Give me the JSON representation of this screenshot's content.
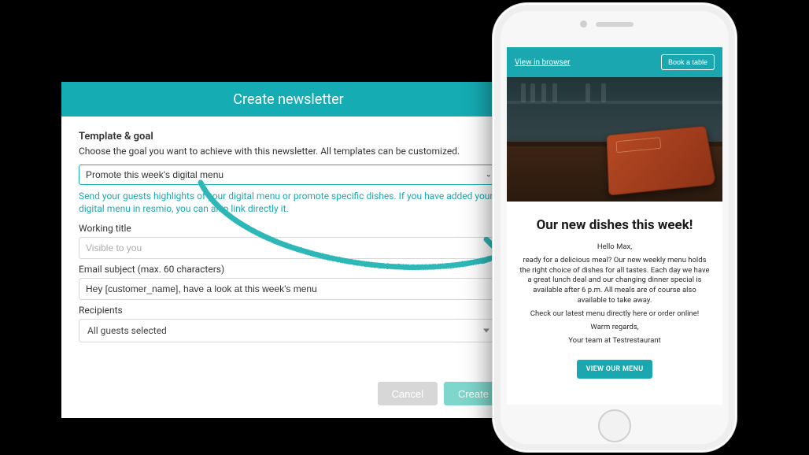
{
  "dialog": {
    "title": "Create newsletter",
    "template_section_title": "Template & goal",
    "template_section_desc": "Choose the goal you want to achieve with this newsletter. All templates can be customized.",
    "template_select_value": "Promote this week's digital menu",
    "template_helper": "Send your guests highlights of your digital menu or promote specific dishes. If you have added your digital menu in resmio, you can also link directly it.",
    "working_title_label": "Working title",
    "working_title_placeholder": "Visible to you",
    "working_title_value": "",
    "subject_label": "Email subject (max. 60 characters)",
    "subject_value": "Hey [customer_name], have a look at this week's menu",
    "recipients_label": "Recipients",
    "recipients_value": "All guests selected",
    "cancel_label": "Cancel",
    "create_label": "Create"
  },
  "preview": {
    "view_in_browser": "View in browser",
    "book_table": "Book a table",
    "headline": "Our new dishes this week!",
    "greeting": "Hello Max,",
    "body1": "ready for a delicious meal? Our new weekly menu holds the right choice of dishes for all tastes. Each day we have a great lunch deal and our changing dinner special is available after 6 p.m. All meals are of course also available to take away.",
    "body2": "Check our latest menu directly here or order online!",
    "regards": "Warm regards,",
    "signature": "Your team at Testrestaurant",
    "cta": "VIEW OUR MENU"
  }
}
